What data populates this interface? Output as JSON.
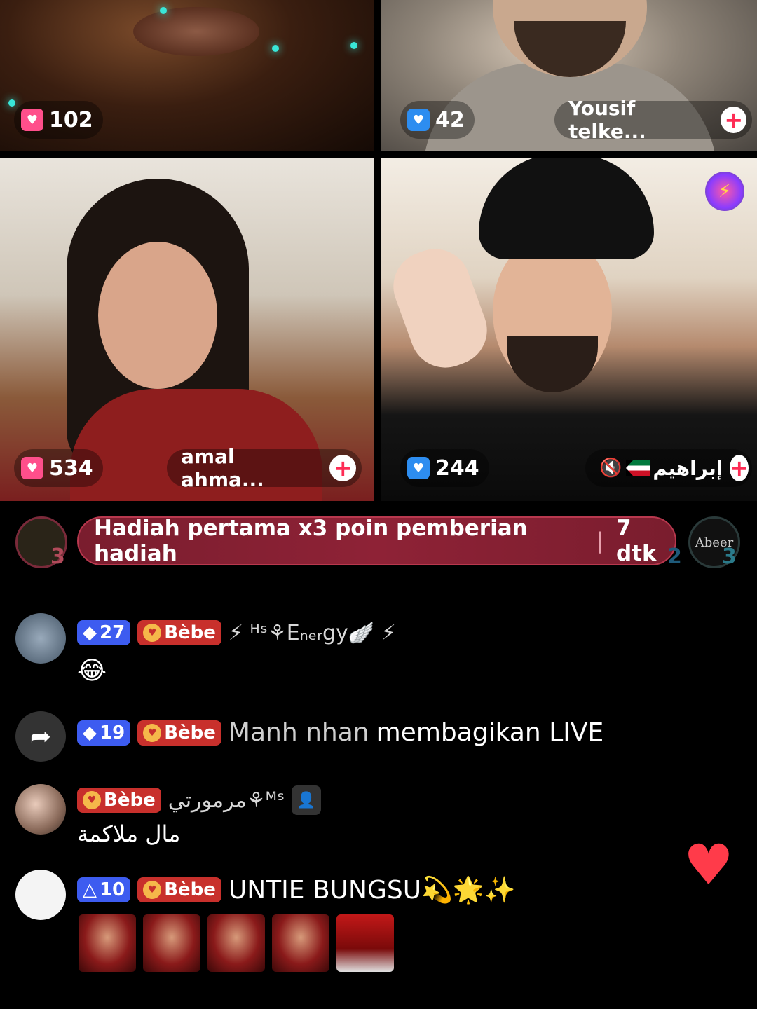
{
  "tiles": [
    {
      "gift_count": "102"
    },
    {
      "gift_count": "42",
      "name": "Yousif telke..."
    },
    {
      "gift_count": "534",
      "name": "amal ahma..."
    },
    {
      "gift_count": "244",
      "name": "إبراهيم",
      "muted": true
    }
  ],
  "banner": {
    "text": "Hadiah pertama x3 poin pemberian hadiah",
    "timer": "7 dtk",
    "left_rank": "3",
    "right_rank": "3",
    "mid_rank": "2",
    "right_avatar_text": "Abeer"
  },
  "comments": [
    {
      "level": "27",
      "fan_badge": "Bèbe",
      "username": "⚡ ᴴˢ⚘Eₙₑᵣgy🪽 ⚡",
      "text": "😂"
    },
    {
      "type": "share",
      "level": "19",
      "fan_badge": "Bèbe",
      "username": "Manh nhan",
      "text": "membagikan LIVE"
    },
    {
      "fan_badge": "Bèbe",
      "username": "مرمورتي⚘ᴹˢ",
      "text": "مال ملاكمة"
    },
    {
      "level": "10",
      "fan_badge": "Bèbe",
      "text": "UNTIE BUNGSU💫🌟✨"
    }
  ],
  "icons": {
    "gift": "gift-icon",
    "plus": "plus-icon",
    "mute": "mute-icon",
    "share": "share-icon",
    "heart": "heart-icon"
  },
  "colors": {
    "accent_red": "#fe2c55",
    "banner_bg": "#8e2236",
    "level_badge": "#3d5cf0",
    "fan_badge": "#c8302c",
    "heart": "#ff3b4a"
  }
}
